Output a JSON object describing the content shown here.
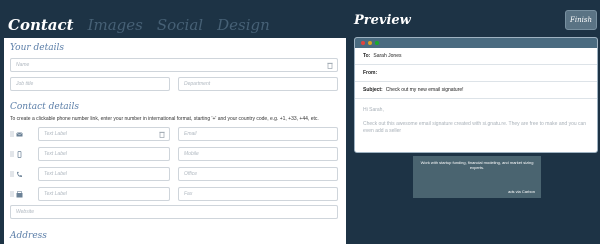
{
  "tabs": [
    "Contact",
    "Images",
    "Social",
    "Design"
  ],
  "sections": {
    "details": "Your details",
    "contact": "Contact details",
    "address": "Address"
  },
  "details": {
    "name_placeholder": "Name",
    "job_placeholder": "Job title",
    "dept_placeholder": "Department"
  },
  "contact_help": "To create a clickable phone number link, enter your number in international format, starting '+' and your country code, e.g. +1, +33, +44, etc.",
  "contact_rows": [
    {
      "icon": "email-icon",
      "label": "Text Label",
      "value": "Email"
    },
    {
      "icon": "mobile-icon",
      "label": "Text Label",
      "value": "Mobile"
    },
    {
      "icon": "phone-icon",
      "label": "Text Label",
      "value": "Office"
    },
    {
      "icon": "fax-icon",
      "label": "Text Label",
      "value": "Fax"
    }
  ],
  "website_placeholder": "Website",
  "preview": {
    "title": "Preview",
    "finish_label": "Finish",
    "to_label": "To:",
    "to_value": "Sarah Jones",
    "from_label": "From:",
    "from_value": "",
    "subject_label": "Subject:",
    "subject_value": "Check out my new email signature!",
    "greeting": "Hi Sarah,",
    "body": "Check out this awesome email signature created with si.gnatu.re. They are free to make and you can even add a seller"
  },
  "banner": {
    "text": "Work with startup funding, financial modeling, and market sizing experts.",
    "sub": "ads via Carbon"
  },
  "colors": {
    "background": "#1d3345",
    "accent": "#5b7ea8",
    "dot_red": "#e0443e",
    "dot_yellow": "#dea123",
    "dot_green": "#1aab29"
  }
}
